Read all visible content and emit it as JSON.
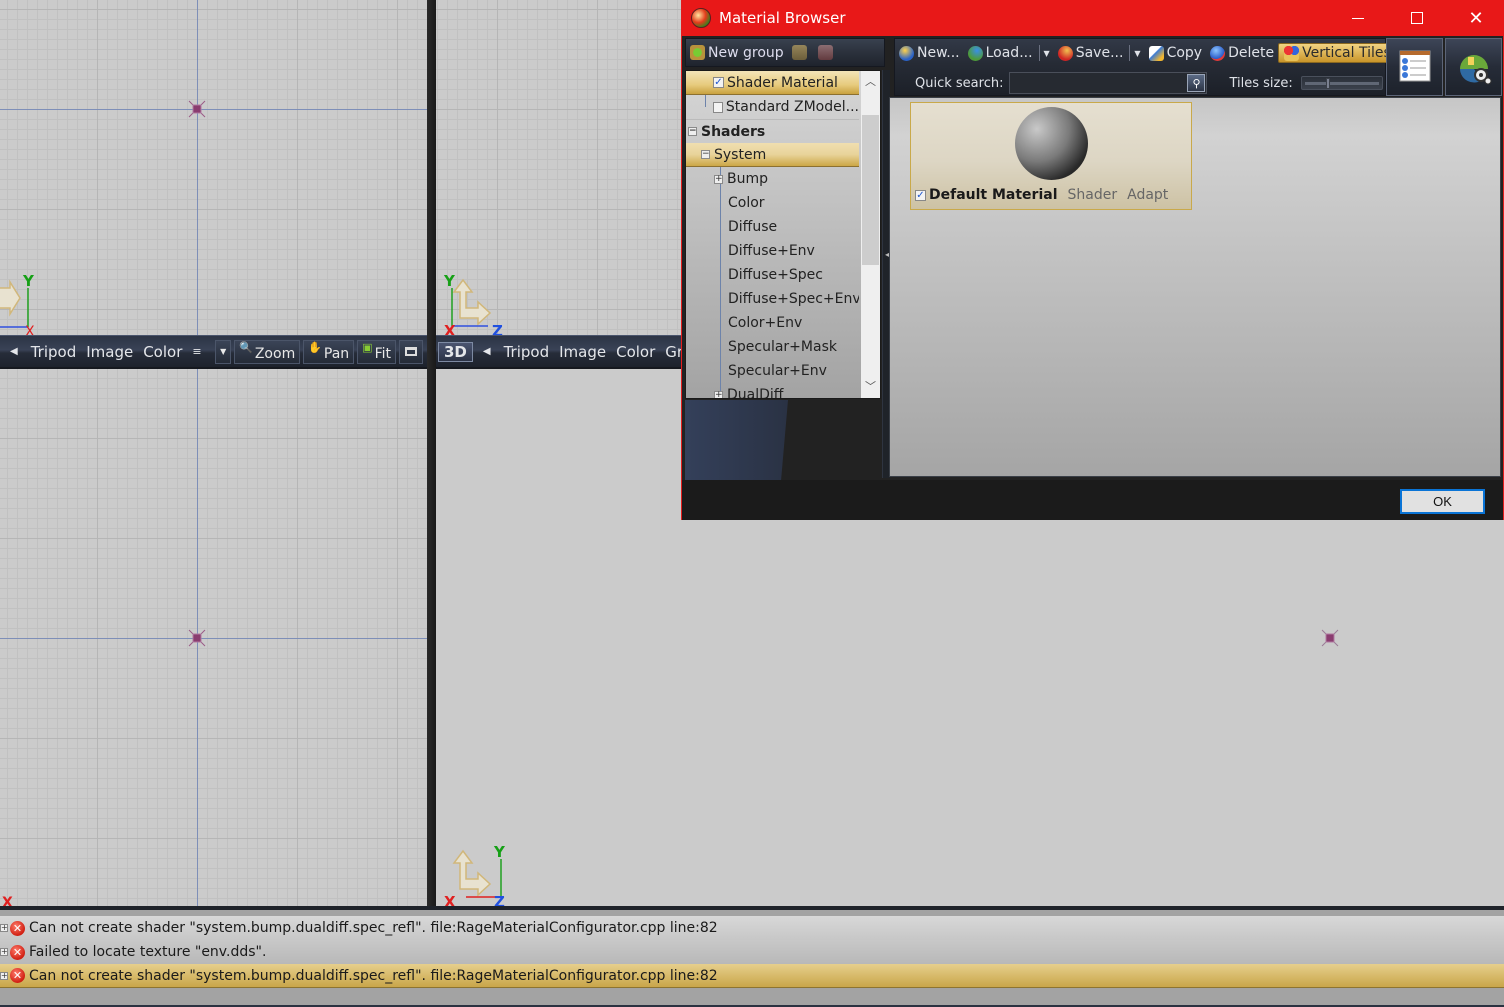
{
  "viewports": {
    "top_left": {
      "axes": {
        "up": "Y",
        "right": "X"
      }
    },
    "top_right": {
      "axes": {
        "up": "Y",
        "left": "X",
        "right": "Z"
      }
    },
    "bottom_left": {
      "axes": {
        "right": "X"
      }
    },
    "bottom_right": {
      "axes": {
        "up": "Y",
        "left": "X",
        "right": "Z"
      }
    }
  },
  "viewport_toolbar_left": {
    "items": [
      "Tripod",
      "Image",
      "Color"
    ],
    "overflow_icon": "≡",
    "zoom_label": "Zoom",
    "pan_label": "Pan",
    "fit_label": "Fit"
  },
  "viewport_toolbar_right": {
    "mode_label": "3D",
    "items": [
      "Tripod",
      "Image",
      "Color",
      "Grid"
    ]
  },
  "dialog": {
    "title": "Material Browser",
    "controls": {
      "minimize": "—",
      "maximize": "☐",
      "close": "✕"
    },
    "left_toolbar": {
      "new_group_label": "New group"
    },
    "toolbar": {
      "new_label": "New...",
      "load_label": "Load...",
      "save_label": "Save...",
      "copy_label": "Copy",
      "delete_label": "Delete",
      "vertical_tiles_label": "Vertical Tiles"
    },
    "quick_search_label": "Quick search:",
    "quick_search_value": "",
    "tiles_size_label": "Tiles size:",
    "tiles_size_value": 0.3,
    "tree": {
      "items": [
        {
          "label": "Shader Material",
          "checked": true,
          "selected": true
        },
        {
          "label": "Standard ZModel...",
          "checked": false
        },
        {
          "label": "Shaders",
          "group": true
        },
        {
          "label": "System",
          "selected": true
        },
        {
          "label": "Bump",
          "expandable": true
        },
        {
          "label": "Color"
        },
        {
          "label": "Diffuse"
        },
        {
          "label": "Diffuse+Env"
        },
        {
          "label": "Diffuse+Spec"
        },
        {
          "label": "Diffuse+Spec+Env"
        },
        {
          "label": "Color+Env"
        },
        {
          "label": "Specular+Mask"
        },
        {
          "label": "Specular+Env"
        },
        {
          "label": "DualDiff",
          "expandable": true
        }
      ]
    },
    "material_tile": {
      "name": "Default Material",
      "type": "Shader",
      "mode": "Adapt",
      "checked": true
    },
    "ok_label": "OK"
  },
  "log": {
    "entries": [
      {
        "level": "error",
        "text": "Can not create shader \"system.bump.dualdiff.spec_refl\". file:RageMaterialConfigurator.cpp line:82"
      },
      {
        "level": "error",
        "text": "Failed to locate texture \"env.dds\"."
      },
      {
        "level": "error",
        "text": "Can not create shader \"system.bump.dualdiff.spec_refl\". file:RageMaterialConfigurator.cpp line:82",
        "selected": true
      }
    ]
  },
  "colors": {
    "titlebar": "#e81818",
    "axis_x": "#e02020",
    "axis_y": "#16a016",
    "axis_z": "#2050e0",
    "selection": "#e7cb7e",
    "ok_border": "#0a74d6"
  }
}
